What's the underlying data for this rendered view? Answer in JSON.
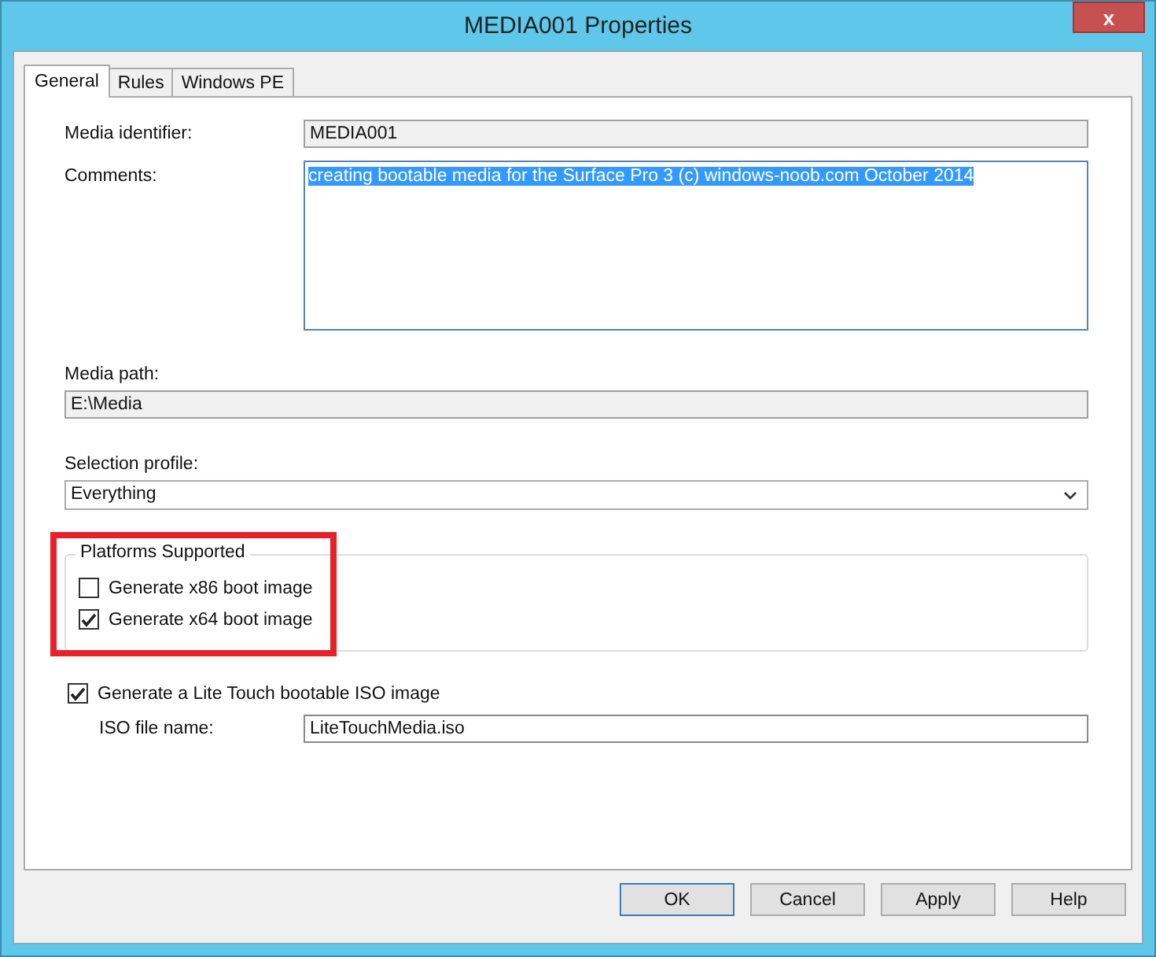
{
  "window": {
    "title": "MEDIA001 Properties",
    "close": "x"
  },
  "tabs": [
    {
      "label": "General",
      "selected": true
    },
    {
      "label": "Rules",
      "selected": false
    },
    {
      "label": "Windows PE",
      "selected": false
    }
  ],
  "media_identifier": {
    "label": "Media identifier:",
    "value": "MEDIA001",
    "readonly": true
  },
  "comments": {
    "label": "Comments:",
    "value": "creating bootable media for the Surface Pro 3 (c) windows-noob.com October 2014",
    "text_selected": true
  },
  "media_path": {
    "label": "Media path:",
    "value": "E:\\Media",
    "readonly": true
  },
  "selection_profile": {
    "label": "Selection profile:",
    "value": "Everything"
  },
  "platforms": {
    "title": "Platforms Supported",
    "highlighted": true,
    "options": [
      {
        "label": "Generate x86 boot image",
        "checked": false
      },
      {
        "label": "Generate x64 boot image",
        "checked": true
      }
    ]
  },
  "iso": {
    "label": "Generate a Lite Touch bootable ISO image",
    "checked": true,
    "file_label": "ISO file name:",
    "file_value": "LiteTouchMedia.iso",
    "readonly": false
  },
  "buttons": [
    {
      "label": "OK",
      "default": true
    },
    {
      "label": "Cancel",
      "default": false
    },
    {
      "label": "Apply",
      "default": false
    },
    {
      "label": "Help",
      "default": false
    }
  ]
}
